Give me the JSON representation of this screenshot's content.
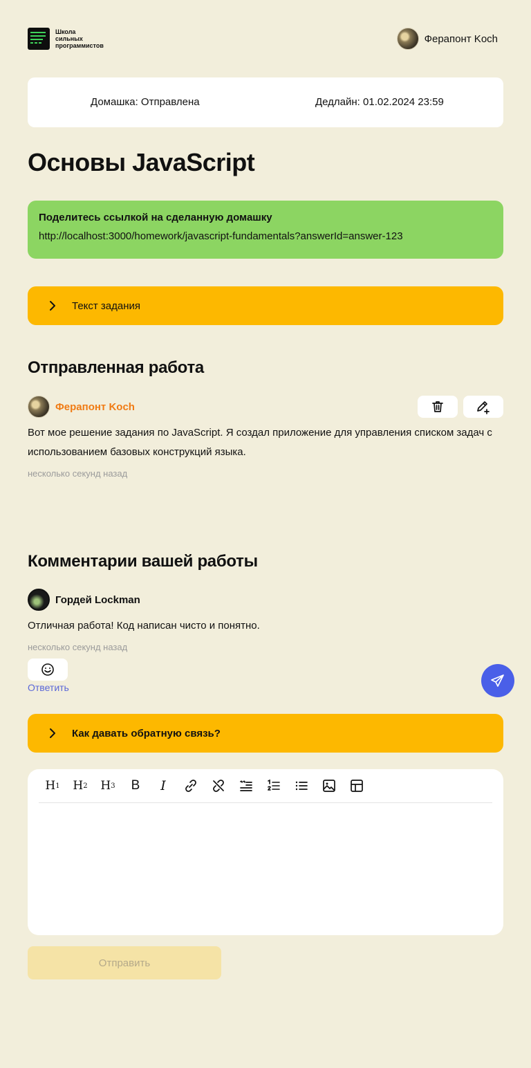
{
  "header": {
    "logo_text": [
      "Школа",
      "сильных",
      "программистов"
    ],
    "user_name": "Ферапонт Koch"
  },
  "status": {
    "homework": "Домашка: Отправлена",
    "deadline": "Дедлайн: 01.02.2024 23:59"
  },
  "page_title": "Основы JavaScript",
  "share": {
    "heading": "Поделитесь ссылкой на сделанную домашку",
    "url": "http://localhost:3000/homework/javascript-fundamentals?answerId=answer-123"
  },
  "task_accordion": {
    "label": "Текст задания"
  },
  "submitted": {
    "heading": "Отправленная работа",
    "author": "Ферапонт Koch",
    "text": "Вот мое решение задания по JavaScript. Я создал приложение для управления списком задач с использованием базовых конструкций языка.",
    "time": "несколько секунд назад",
    "author_color": "#f07b14"
  },
  "comments": {
    "heading": "Комментарии вашей работы",
    "items": [
      {
        "author": "Гордей Lockman",
        "text": "Отличная работа! Код написан чисто и понятно.",
        "time": "несколько секунд назад",
        "reply_label": "Ответить"
      }
    ]
  },
  "feedback_accordion": {
    "label": "Как давать обратную связь?"
  },
  "editor": {
    "toolbar": [
      "heading-1-icon",
      "heading-2-icon",
      "heading-3-icon",
      "bold-icon",
      "italic-icon",
      "link-icon",
      "unlink-icon",
      "blockquote-icon",
      "ordered-list-icon",
      "bullet-list-icon",
      "image-icon",
      "table-icon"
    ],
    "submit_label": "Отправить"
  },
  "colors": {
    "background": "#f2eedb",
    "accent_yellow": "#fdb800",
    "share_green": "#8cd562",
    "fab_blue": "#4a5fe8"
  }
}
